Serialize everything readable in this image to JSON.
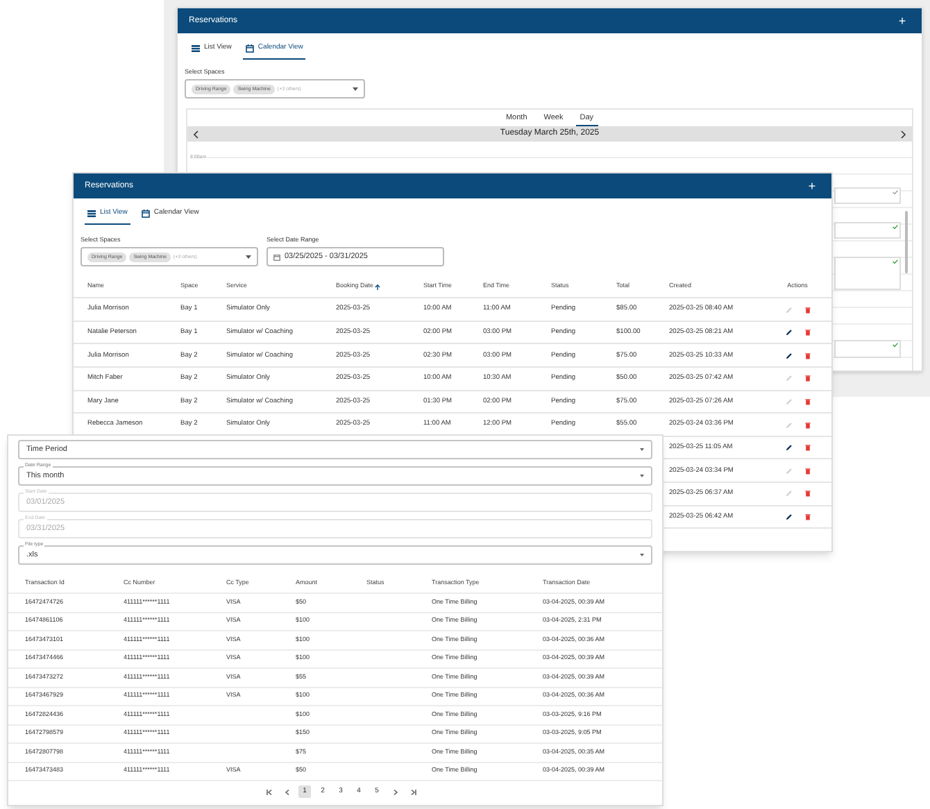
{
  "calendar_window": {
    "title": "Reservations",
    "add_button": "+",
    "tabs": [
      {
        "label": "List View",
        "selected": false
      },
      {
        "label": "Calendar View",
        "selected": true
      }
    ],
    "spaces_label": "Select Spaces",
    "spaces_chips": [
      "Driving Range",
      "Swing Machine"
    ],
    "spaces_more": "(+3 others)",
    "view_tabs": [
      {
        "label": "Month",
        "selected": false
      },
      {
        "label": "Week",
        "selected": false
      },
      {
        "label": "Day",
        "selected": true
      }
    ],
    "date_heading": "Tuesday March 25th, 2025",
    "time_label": "8:00am",
    "events": [
      {
        "confirmed": false
      },
      {
        "confirmed": true
      },
      {
        "confirmed": true
      },
      {
        "confirmed": true
      }
    ]
  },
  "list_window": {
    "title": "Reservations",
    "add_button": "+",
    "tabs": [
      {
        "label": "List View",
        "selected": true
      },
      {
        "label": "Calendar View",
        "selected": false
      }
    ],
    "spaces_label": "Select Spaces",
    "spaces_chips": [
      "Driving Range",
      "Swing Machine"
    ],
    "spaces_more": "(+3 others)",
    "date_range_label": "Select Date Range",
    "date_range_value": "03/25/2025 - 03/31/2025",
    "columns": [
      {
        "label": "Name",
        "sorted": false
      },
      {
        "label": "Space",
        "sorted": false
      },
      {
        "label": "Service",
        "sorted": false
      },
      {
        "label": "Booking Date",
        "sorted": true
      },
      {
        "label": "Start Time",
        "sorted": false
      },
      {
        "label": "End Time",
        "sorted": false
      },
      {
        "label": "Status",
        "sorted": false
      },
      {
        "label": "Total",
        "sorted": false
      },
      {
        "label": "Created",
        "sorted": false
      },
      {
        "label": "Actions",
        "sorted": false
      }
    ],
    "rows": [
      {
        "name": "Julia Morrison",
        "space": "Bay 1",
        "service": "Simulator Only",
        "booking_date": "2025-03-25",
        "start": "10:00 AM",
        "end": "11:00 AM",
        "status": "Pending",
        "total": "$85.00",
        "created": "2025-03-25 08:40 AM",
        "editable": false
      },
      {
        "name": "Natalie Peterson",
        "space": "Bay 1",
        "service": "Simulator w/ Coaching",
        "booking_date": "2025-03-25",
        "start": "02:00 PM",
        "end": "03:00 PM",
        "status": "Pending",
        "total": "$100.00",
        "created": "2025-03-25 08:21 AM",
        "editable": true
      },
      {
        "name": "Julia Morrison",
        "space": "Bay 2",
        "service": "Simulator w/ Coaching",
        "booking_date": "2025-03-25",
        "start": "02:30 PM",
        "end": "03:00 PM",
        "status": "Pending",
        "total": "$75.00",
        "created": "2025-03-25 10:33 AM",
        "editable": true
      },
      {
        "name": "Mitch Faber",
        "space": "Bay 2",
        "service": "Simulator Only",
        "booking_date": "2025-03-25",
        "start": "10:00 AM",
        "end": "10:30 AM",
        "status": "Pending",
        "total": "$50.00",
        "created": "2025-03-25 07:42 AM",
        "editable": false
      },
      {
        "name": "Mary Jane",
        "space": "Bay 2",
        "service": "Simulator w/ Coaching",
        "booking_date": "2025-03-25",
        "start": "01:30 PM",
        "end": "02:00 PM",
        "status": "Pending",
        "total": "$75.00",
        "created": "2025-03-25 07:26 AM",
        "editable": false
      },
      {
        "name": "Rebecca Jameson",
        "space": "Bay 2",
        "service": "Simulator Only",
        "booking_date": "2025-03-25",
        "start": "11:00 AM",
        "end": "12:00 PM",
        "status": "Pending",
        "total": "$55.00",
        "created": "2025-03-24 03:36 PM",
        "editable": false
      },
      {
        "created": "2025-03-25 11:05 AM",
        "editable": true
      },
      {
        "created": "2025-03-24 03:34 PM",
        "editable": false
      },
      {
        "created": "2025-03-25 06:37 AM",
        "editable": false
      },
      {
        "created": "2025-03-25 06:42 AM",
        "editable": true
      }
    ]
  },
  "report_window": {
    "fields": [
      {
        "kind": "select",
        "value": "Time Period",
        "disabled": false
      },
      {
        "kind": "select",
        "label": "Date Range",
        "value": "This month",
        "disabled": false
      },
      {
        "kind": "date",
        "label": "Start Date",
        "value": "03/01/2025",
        "disabled": true
      },
      {
        "kind": "date",
        "label": "End Date",
        "value": "03/31/2025",
        "disabled": true
      },
      {
        "kind": "select",
        "label": "File type",
        "value": ".xls",
        "disabled": false
      }
    ],
    "columns": [
      "Transaction Id",
      "Cc Number",
      "Cc Type",
      "Amount",
      "Status",
      "Transaction Type",
      "Transaction Date"
    ],
    "rows": [
      {
        "id": "16472474726",
        "cc_number": "411111******1111",
        "cc_type": "VISA",
        "amount": "$50",
        "type": "One Time Billing",
        "date": "03-04-2025, 00:39 AM"
      },
      {
        "id": "16474861106",
        "cc_number": "411111******1111",
        "cc_type": "VISA",
        "amount": "$100",
        "type": "One Time Billing",
        "date": "03-04-2025, 2:31 PM"
      },
      {
        "id": "16473473101",
        "cc_number": "411111******1111",
        "cc_type": "VISA",
        "amount": "$100",
        "type": "One Time Billing",
        "date": "03-04-2025, 00:36 AM"
      },
      {
        "id": "16473474466",
        "cc_number": "411111******1111",
        "cc_type": "VISA",
        "amount": "$100",
        "type": "One Time Billing",
        "date": "03-04-2025, 00:39 AM"
      },
      {
        "id": "16473473272",
        "cc_number": "411111******1111",
        "cc_type": "VISA",
        "amount": "$55",
        "type": "One Time Billing",
        "date": "03-04-2025, 00:39 AM"
      },
      {
        "id": "16473467929",
        "cc_number": "411111******1111",
        "cc_type": "VISA",
        "amount": "$100",
        "type": "One Time Billing",
        "date": "03-04-2025, 00:36 AM"
      },
      {
        "id": "16472824436",
        "cc_number": "411111******1111",
        "amount": "$100",
        "type": "One Time Billing",
        "date": "03-03-2025, 9:16 PM"
      },
      {
        "id": "16472798579",
        "cc_number": "411111******1111",
        "amount": "$150",
        "type": "One Time Billing",
        "date": "03-03-2025, 9:05 PM"
      },
      {
        "id": "16472807798",
        "cc_number": "411111******1111",
        "amount": "$75",
        "type": "One Time Billing",
        "date": "03-04-2025, 00:35 AM"
      },
      {
        "id": "16473473483",
        "cc_number": "411111******1111",
        "cc_type": "VISA",
        "amount": "$50",
        "type": "One Time Billing",
        "date": "03-04-2025, 00:39 AM"
      }
    ],
    "pages": [
      {
        "label": "1",
        "selected": true
      },
      {
        "label": "2",
        "selected": false
      },
      {
        "label": "3",
        "selected": false
      },
      {
        "label": "4",
        "selected": false
      },
      {
        "label": "5",
        "selected": false
      }
    ]
  }
}
